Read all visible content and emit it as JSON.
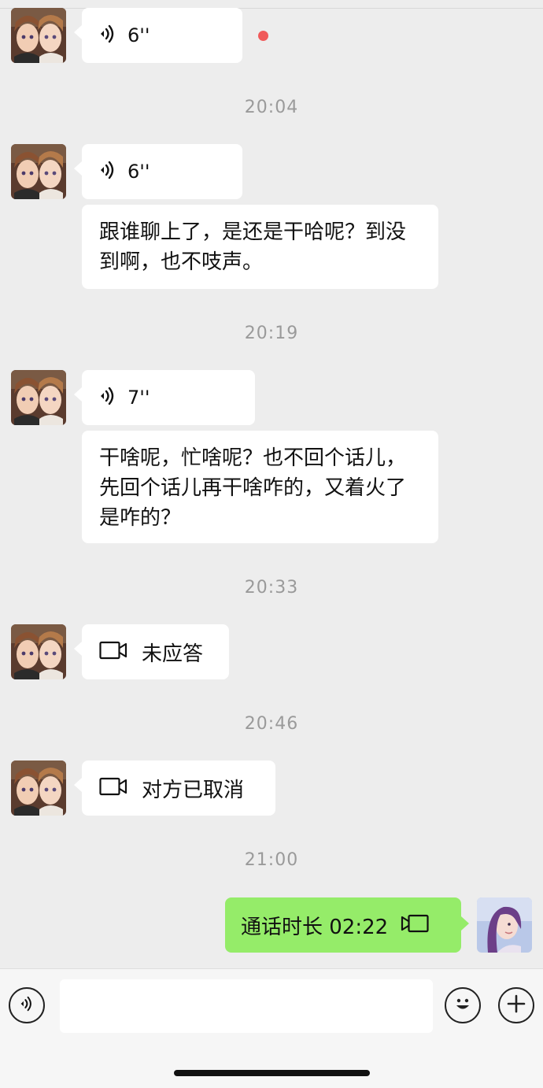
{
  "messages": [
    {
      "type": "voice",
      "duration": "6''",
      "unread": true
    },
    {
      "type": "timestamp",
      "text": "20:04"
    },
    {
      "type": "voice",
      "duration": "6''"
    },
    {
      "type": "text",
      "text": "跟谁聊上了，是还是干哈呢？到没到啊，也不吱声。"
    },
    {
      "type": "timestamp",
      "text": "20:19"
    },
    {
      "type": "voice",
      "duration": "7''"
    },
    {
      "type": "text",
      "text": "干啥呢，忙啥呢？也不回个话儿，先回个话儿再干啥咋的，又着火了是咋的？"
    },
    {
      "type": "timestamp",
      "text": "20:33"
    },
    {
      "type": "video_call",
      "text": "未应答",
      "icon": "video-camera-icon"
    },
    {
      "type": "timestamp",
      "text": "20:46"
    },
    {
      "type": "video_call",
      "text": "对方已取消",
      "icon": "video-camera-icon"
    },
    {
      "type": "timestamp",
      "text": "21:00"
    },
    {
      "type": "video_call",
      "sender": "me",
      "text": "通话时长 02:22",
      "icon": "video-camera-icon"
    }
  ],
  "input_bar": {
    "left_icon": "voice-toggle-icon",
    "placeholder": "",
    "right_icons": [
      "emoji-icon",
      "plus-icon"
    ]
  },
  "colors": {
    "background": "#ededed",
    "bubble_incoming": "#ffffff",
    "bubble_outgoing": "#95ec69",
    "unread_dot": "#f05a5a",
    "timestamp_text": "#9a9a9a"
  }
}
